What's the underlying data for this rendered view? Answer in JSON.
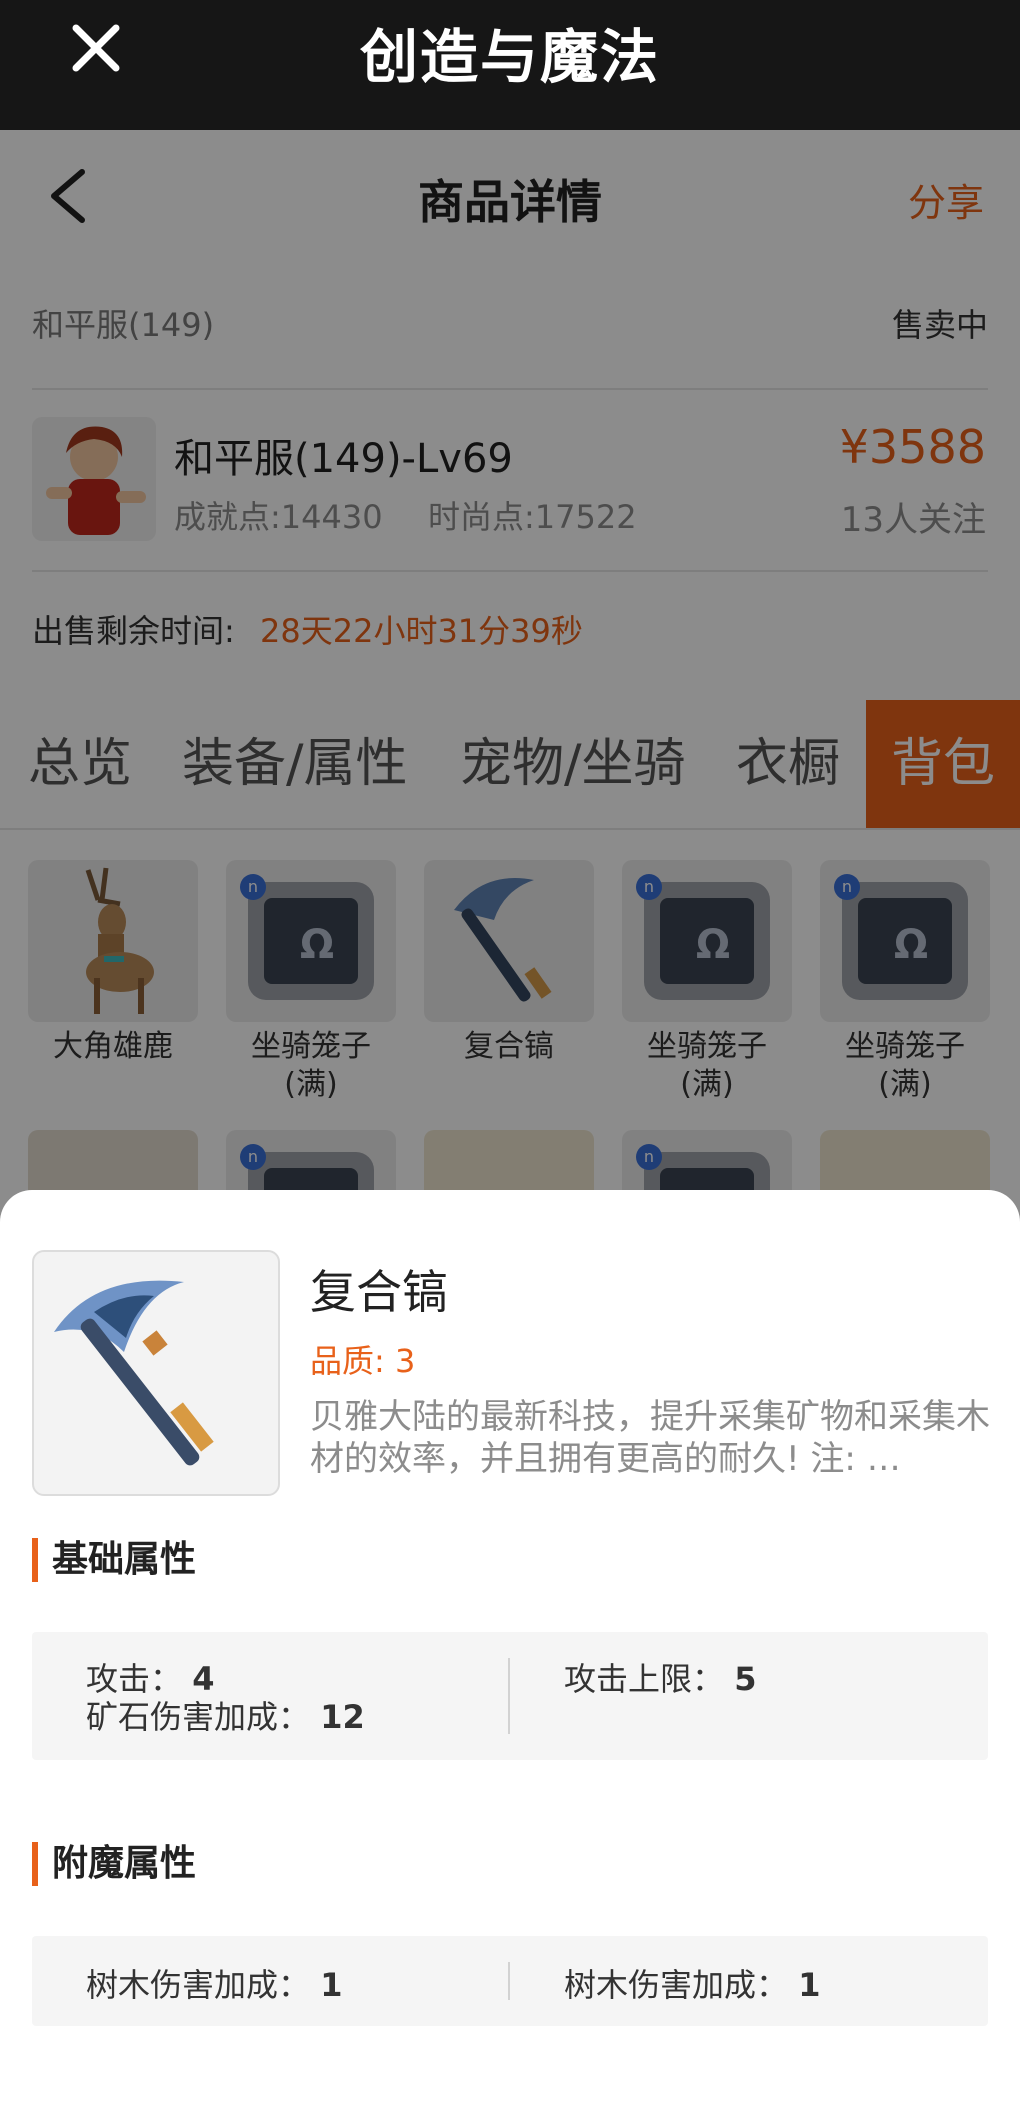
{
  "app": {
    "title": "创造与魔法"
  },
  "nav": {
    "title": "商品详情",
    "share": "分享"
  },
  "listing": {
    "seller": "和平服(149)",
    "status": "售卖中",
    "name": "和平服(149)-Lv69",
    "achievement": "成就点:14430",
    "fashion": "时尚点:17522",
    "price": "¥3588",
    "followers": "13人关注",
    "remain_label": "出售剩余时间:",
    "remain_time": "28天22小时31分39秒"
  },
  "tabs": [
    {
      "label": "总览"
    },
    {
      "label": "装备/属性"
    },
    {
      "label": "宠物/坐骑"
    },
    {
      "label": "衣橱"
    },
    {
      "label": "背包",
      "active": true
    }
  ],
  "bag_items": [
    {
      "label": "大角雄鹿",
      "icon": "deer-icon"
    },
    {
      "label": "坐骑笼子\n(满)",
      "icon": "cage-icon"
    },
    {
      "label": "复合镐",
      "icon": "pickaxe-icon"
    },
    {
      "label": "坐骑笼子\n(满)",
      "icon": "cage-icon"
    },
    {
      "label": "坐骑笼子\n(满)",
      "icon": "cage-icon"
    }
  ],
  "detail": {
    "name": "复合镐",
    "quality": "品质: 3",
    "description": "贝雅大陆的最新科技，提升采集矿物和采集木材的效率，并且拥有更高的耐久! 注: …",
    "basic_title": "基础属性",
    "basic": [
      {
        "label": "攻击：",
        "value": "4"
      },
      {
        "label": "矿石伤害加成：",
        "value": "12"
      },
      {
        "label": "攻击上限：",
        "value": "5"
      }
    ],
    "enchant_title": "附魔属性",
    "enchant": [
      {
        "label": "树木伤害加成：",
        "value": "1"
      },
      {
        "label": "树木伤害加成：",
        "value": "1"
      }
    ]
  },
  "colors": {
    "accent": "#e8611a",
    "topbar": "#161616"
  }
}
